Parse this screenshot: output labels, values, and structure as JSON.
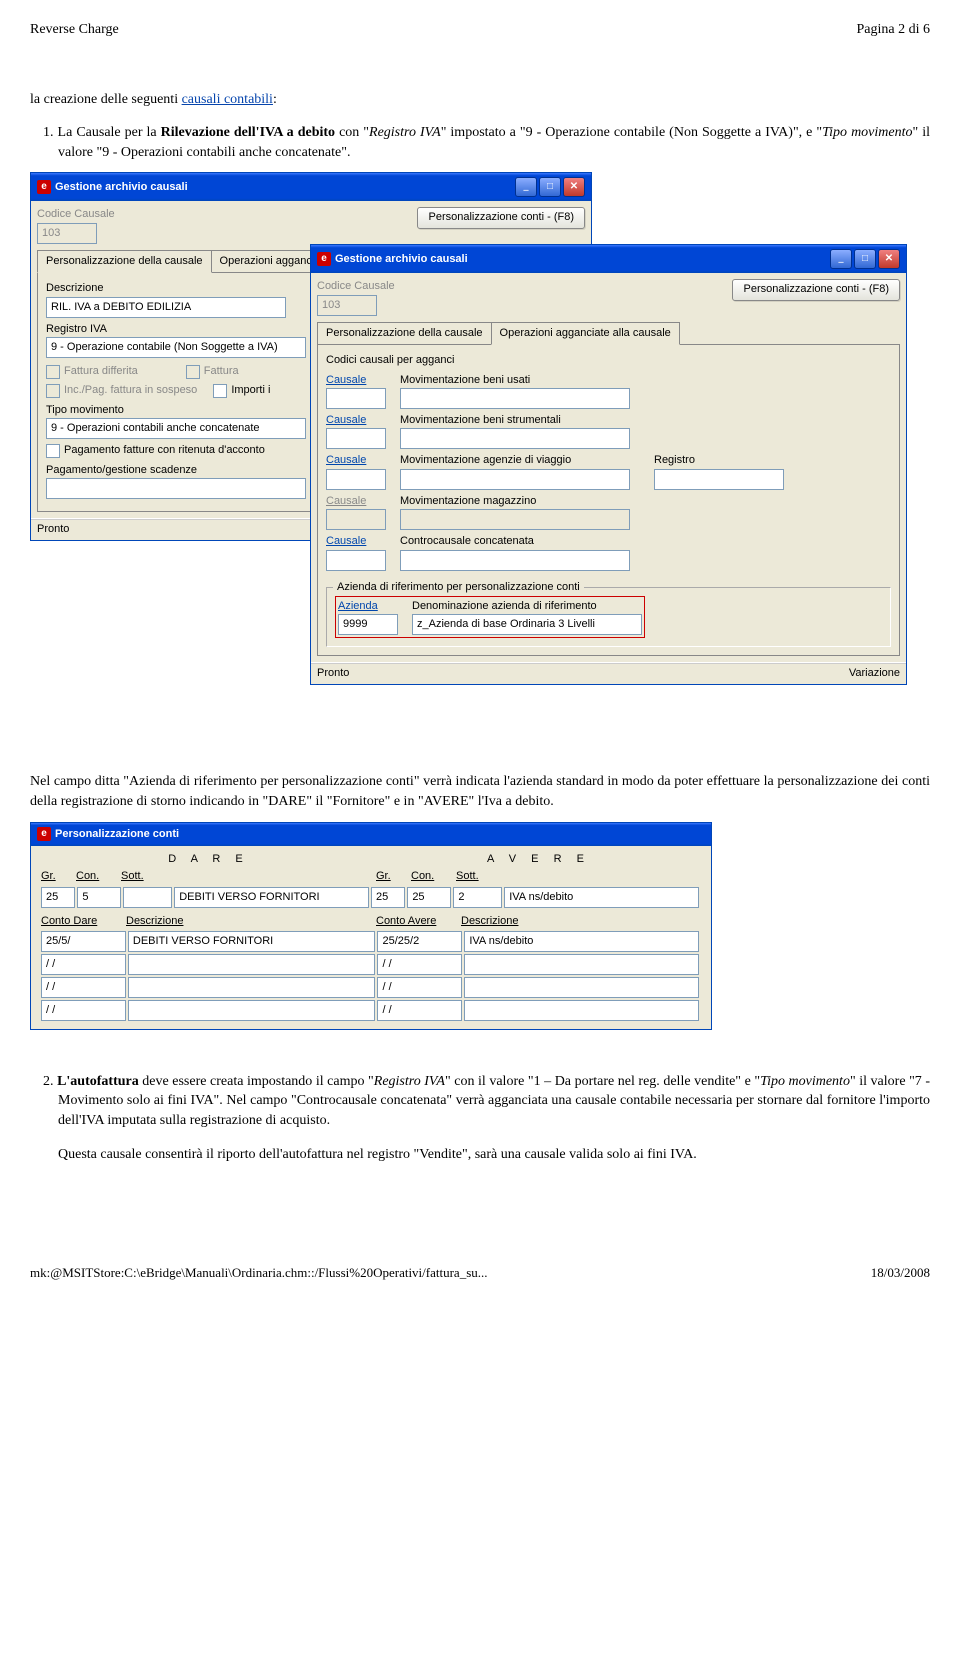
{
  "header": {
    "left": "Reverse Charge",
    "right": "Pagina 2 di 6"
  },
  "intro": {
    "prefix": "la creazione delle seguenti ",
    "link": "causali contabili",
    "suffix": ":"
  },
  "para1": {
    "num": "1. ",
    "text": "La Causale per la ",
    "bold": "Rilevazione dell'IVA a debito",
    "text2": " con \"",
    "it1": "Registro IVA",
    "text3": "\" impostato a \"9 - Operazione contabile (Non Soggette a IVA)\", e \"",
    "it2": "Tipo movimento",
    "text4": "\" il valore \"9 - Operazioni contabili anche concatenate\"."
  },
  "window1": {
    "title": "Gestione archivio causali",
    "label_codice": "Codice Causale",
    "codice": "103",
    "btn_pers": "Personalizzazione conti - (F8)",
    "tab1": "Personalizzazione della causale",
    "tab2": "Operazioni agganciate alla causale",
    "label_descr": "Descrizione",
    "descr": "RIL. IVA a DEBITO EDILIZIA",
    "label_reg": "Registro IVA",
    "reg": "9 - Operazione contabile (Non Soggette a IVA)",
    "cb1": "Fattura differita",
    "cb2": "Fattura",
    "cb3": "Inc./Pag. fattura in sospeso",
    "cb4": "Importi i",
    "label_tipo": "Tipo movimento",
    "tipo": "9 - Operazioni contabili anche concatenate",
    "cb5": "Pagamento fatture con ritenuta d'acconto",
    "label_pag": "Pagamento/gestione scadenze",
    "status": "Pronto"
  },
  "window2": {
    "title": "Gestione archivio causali",
    "label_codice": "Codice Causale",
    "codice": "103",
    "btn_pers": "Personalizzazione conti - (F8)",
    "tab1": "Personalizzazione della causale",
    "tab2": "Operazioni agganciate alla causale",
    "section": "Codici causali per agganci",
    "link_causale": "Causale",
    "row1": "Movimentazione beni usati",
    "row2": "Movimentazione beni strumentali",
    "row3": "Movimentazione agenzie di viaggio",
    "row3_extra": "Registro",
    "row4": "Movimentazione magazzino",
    "row5": "Controcausale concatenata",
    "fieldset_label": "Azienda di riferimento per personalizzazione conti",
    "link_azienda": "Azienda",
    "azienda": "9999",
    "label_denom": "Denominazione azienda di riferimento",
    "denom": "z_Azienda di base Ordinaria 3 Livelli",
    "status_l": "Pronto",
    "status_r": "Variazione"
  },
  "middle_text": "Nel campo ditta \"Azienda di riferimento per personalizzazione conti\" verrà indicata l'azienda standard in modo da poter effettuare la personalizzazione dei conti della registrazione di storno indicando in \"DARE\" il \"Fornitore\" e in \"AVERE\" l'Iva a debito.",
  "window3": {
    "title": "Personalizzazione conti",
    "hdr_dare": "D A R E",
    "hdr_avere": "A V E R E",
    "col_gr": "Gr.",
    "col_con": "Con.",
    "col_sott": "Sott.",
    "r1": {
      "gr1": "25",
      "con1": "5",
      "sott1": "",
      "desc1": "DEBITI VERSO FORNITORI",
      "gr2": "25",
      "con2": "25",
      "sott2": "2",
      "desc2": "IVA ns/debito"
    },
    "label_conto_dare": "Conto Dare",
    "label_descr": "Descrizione",
    "label_conto_avere": "Conto Avere",
    "r2": {
      "cd": "25/5/",
      "d1": "DEBITI VERSO FORNITORI",
      "ca": "25/25/2",
      "d2": "IVA ns/debito"
    },
    "slash": "/  /"
  },
  "para2": {
    "num": "2. ",
    "bold": "L'autofattura",
    "text1": " deve essere creata impostando il campo \"",
    "it1": "Registro IVA",
    "text2": "\" con il valore \"1 – Da portare nel reg. delle vendite\" e \"",
    "it2": "Tipo movimento",
    "text3": "\" il valore \"7 - Movimento solo ai fini IVA\". Nel campo \"Controcausale concatenata\" verrà agganciata una causale contabile necessaria per stornare dal fornitore l'importo dell'IVA imputata sulla registrazione di acquisto."
  },
  "para3": "Questa causale consentirà il riporto dell'autofattura nel registro \"Vendite\", sarà una causale valida solo ai fini IVA.",
  "footer": {
    "left": "mk:@MSITStore:C:\\eBridge\\Manuali\\Ordinaria.chm::/Flussi%20Operativi/fattura_su...",
    "right": "18/03/2008"
  }
}
